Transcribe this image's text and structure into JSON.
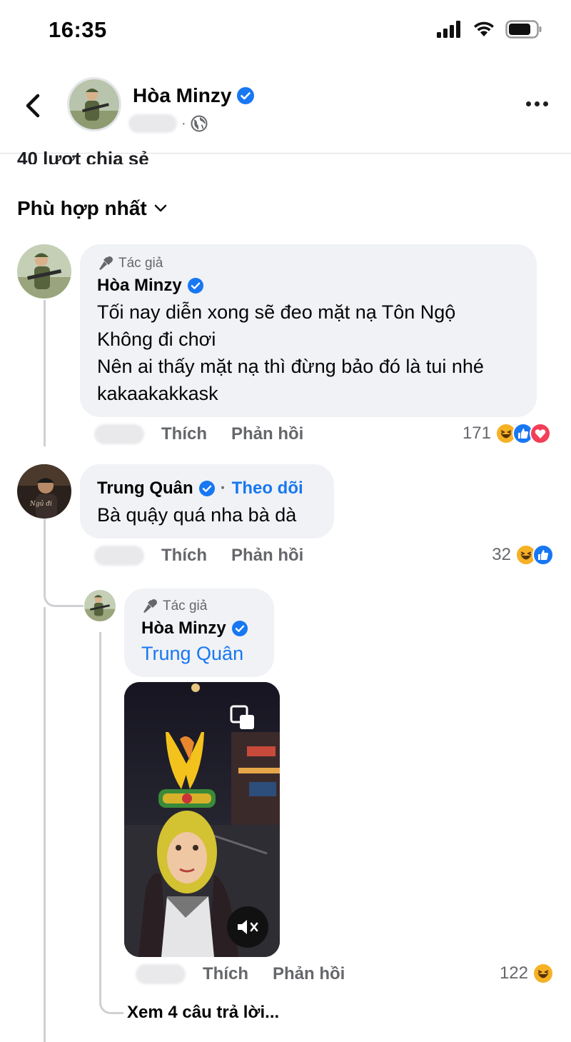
{
  "status": {
    "time": "16:35"
  },
  "header": {
    "name": "Hòa Minzy"
  },
  "post": {
    "shares_text": "40 lượt chia sẻ"
  },
  "sort": {
    "label": "Phù hợp nhất"
  },
  "comments": [
    {
      "author_badge": "Tác giả",
      "name": "Hòa Minzy",
      "lines": [
        "Tối nay diễn xong sẽ đeo mặt nạ Tôn Ngộ",
        "Không đi chơi",
        "Nên ai thấy mặt nạ thì đừng bảo đó là tui nhé",
        "kakaakakkask"
      ],
      "like_label": "Thích",
      "reply_label": "Phản hồi",
      "reaction_count": "171",
      "reactions": [
        "haha",
        "like",
        "love"
      ]
    },
    {
      "name": "Trung Quân",
      "follow_label": "Theo dõi",
      "text": "Bà quậy quá nha bà dà",
      "like_label": "Thích",
      "reply_label": "Phản hồi",
      "reaction_count": "32",
      "reactions": [
        "haha",
        "like"
      ]
    }
  ],
  "reply": {
    "author_badge": "Tác giả",
    "name": "Hòa Minzy",
    "mention": "Trung Quân",
    "like_label": "Thích",
    "reply_label": "Phản hồi",
    "reaction_count": "122",
    "reactions": [
      "haha"
    ]
  },
  "view_more": "Xem 4 câu trả lời...",
  "colors": {
    "accent": "#1877f2",
    "bubble": "#f0f2f5",
    "muted": "#65676b",
    "love": "#f33e58",
    "haha": "#f7b125"
  }
}
